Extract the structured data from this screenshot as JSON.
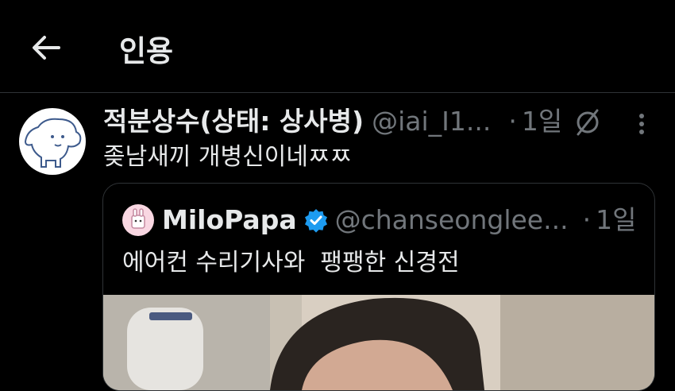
{
  "header": {
    "title": "인용"
  },
  "tweet": {
    "author_name": "적분상수(상태: 상사병)",
    "handle": "@iai_I1...",
    "separator": "·",
    "time": "1일",
    "text": "좆남새끼 개병신이네ㅉㅉ"
  },
  "quote": {
    "author_name": "MiloPapa",
    "handle": "@chanseonglee...",
    "separator": "·",
    "time": "1일",
    "text": "에어컨 수리기사와  팽팽한 신경전"
  },
  "colors": {
    "background": "#000000",
    "text": "#e7e9ea",
    "secondary": "#71767b",
    "verified": "#1d9bf0",
    "border": "#2f3336"
  }
}
